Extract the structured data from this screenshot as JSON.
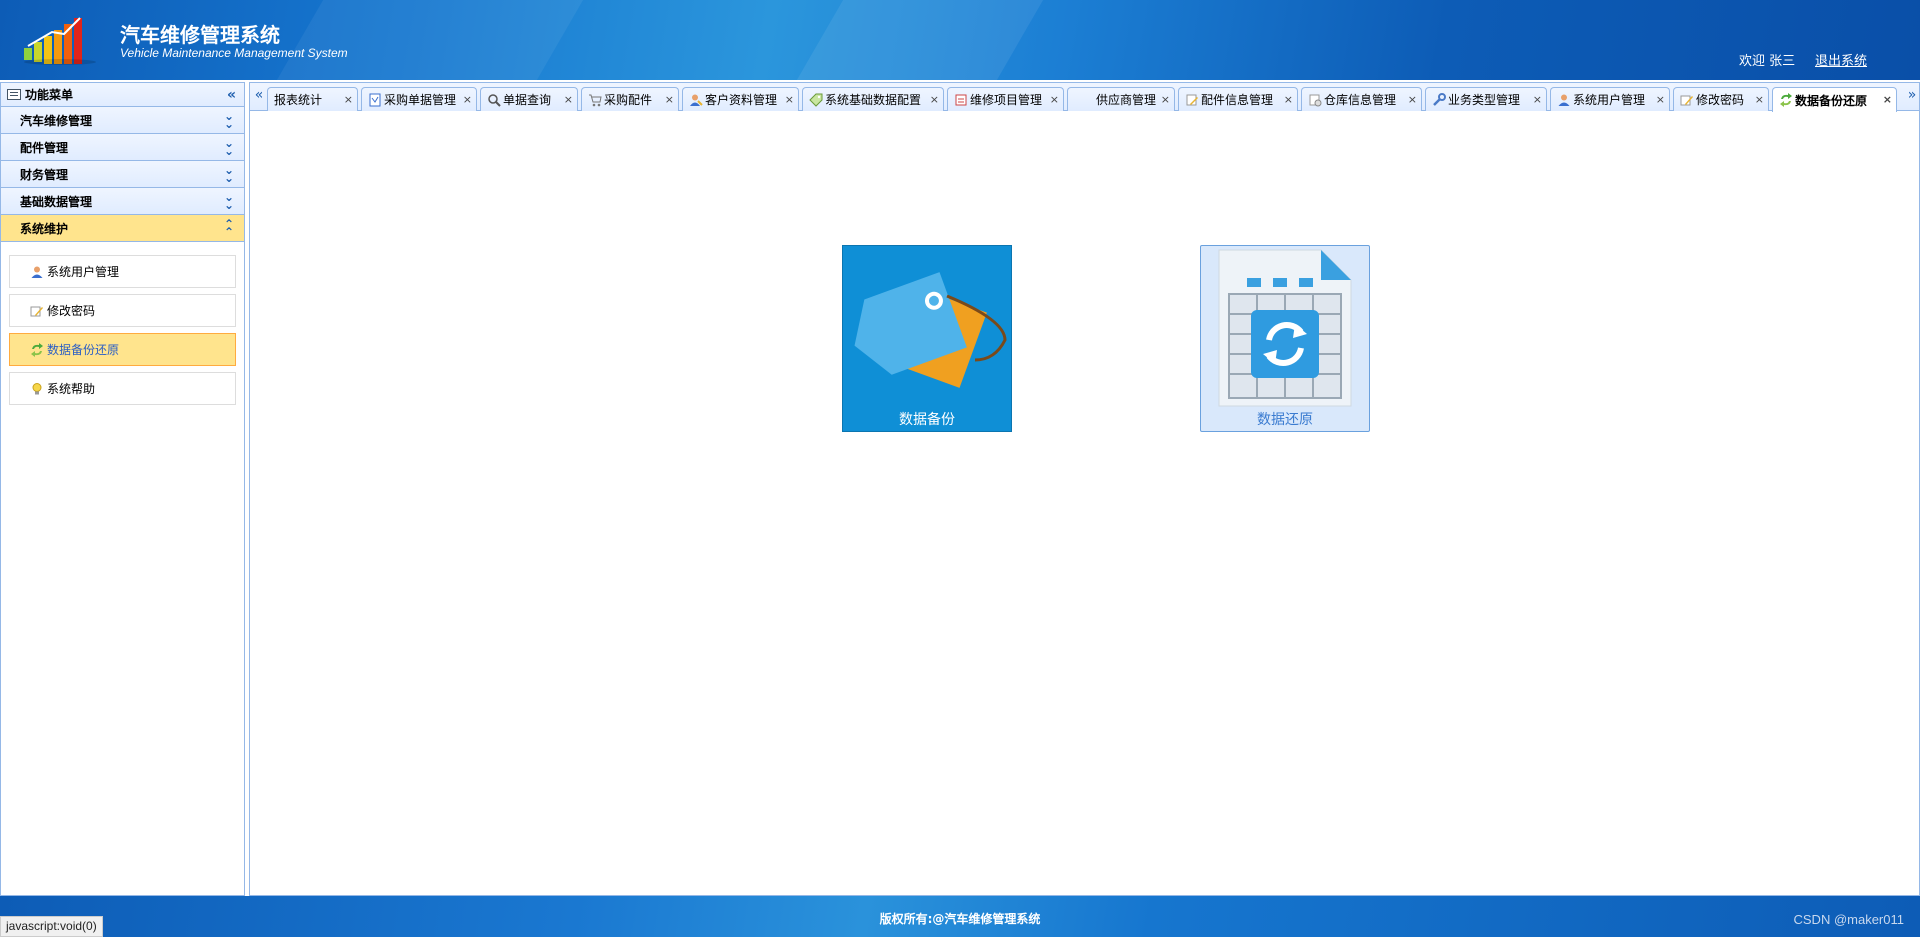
{
  "header": {
    "title": "汽车维修管理系统",
    "subtitle": "Vehicle Maintenance Management System",
    "welcome": "欢迎 张三",
    "logout_label": "退出系统"
  },
  "sidebar": {
    "title": "功能菜单",
    "sections": [
      {
        "label": "汽车维修管理",
        "expanded": false
      },
      {
        "label": "配件管理",
        "expanded": false
      },
      {
        "label": "财务管理",
        "expanded": false
      },
      {
        "label": "基础数据管理",
        "expanded": false
      },
      {
        "label": "系统维护",
        "expanded": true
      }
    ],
    "sub_items": [
      {
        "label": "系统用户管理",
        "icon": "user-icon"
      },
      {
        "label": "修改密码",
        "icon": "edit-icon"
      },
      {
        "label": "数据备份还原",
        "icon": "sync-icon",
        "active": true
      },
      {
        "label": "系统帮助",
        "icon": "bulb-icon"
      }
    ]
  },
  "tabs": [
    {
      "label": "报表统计",
      "icon": ""
    },
    {
      "label": "采购单据管理",
      "icon": "document-icon"
    },
    {
      "label": "单据查询",
      "icon": "search-icon"
    },
    {
      "label": "采购配件",
      "icon": "cart-icon"
    },
    {
      "label": "客户资料管理",
      "icon": "customer-icon"
    },
    {
      "label": "系统基础数据配置",
      "icon": "tag-icon"
    },
    {
      "label": "维修项目管理",
      "icon": "repair-icon"
    },
    {
      "label": "供应商管理",
      "icon": ""
    },
    {
      "label": "配件信息管理",
      "icon": "parts-icon"
    },
    {
      "label": "仓库信息管理",
      "icon": "warehouse-icon"
    },
    {
      "label": "业务类型管理",
      "icon": "wrench-icon"
    },
    {
      "label": "系统用户管理",
      "icon": "user-icon"
    },
    {
      "label": "修改密码",
      "icon": "edit-icon"
    },
    {
      "label": "数据备份还原",
      "icon": "sync-icon",
      "active": true
    }
  ],
  "tiles": {
    "backup_label": "数据备份",
    "restore_label": "数据还原"
  },
  "footer": {
    "copyright": "版权所有:@汽车维修管理系统",
    "watermark": "CSDN @maker011"
  },
  "status_url": "javascript:void(0)",
  "colors": {
    "header_blue": "#0d5cb6",
    "panel_border": "#95b8e7",
    "active_yellow": "#ffe48d",
    "tile_blue": "#0f8fd6"
  }
}
